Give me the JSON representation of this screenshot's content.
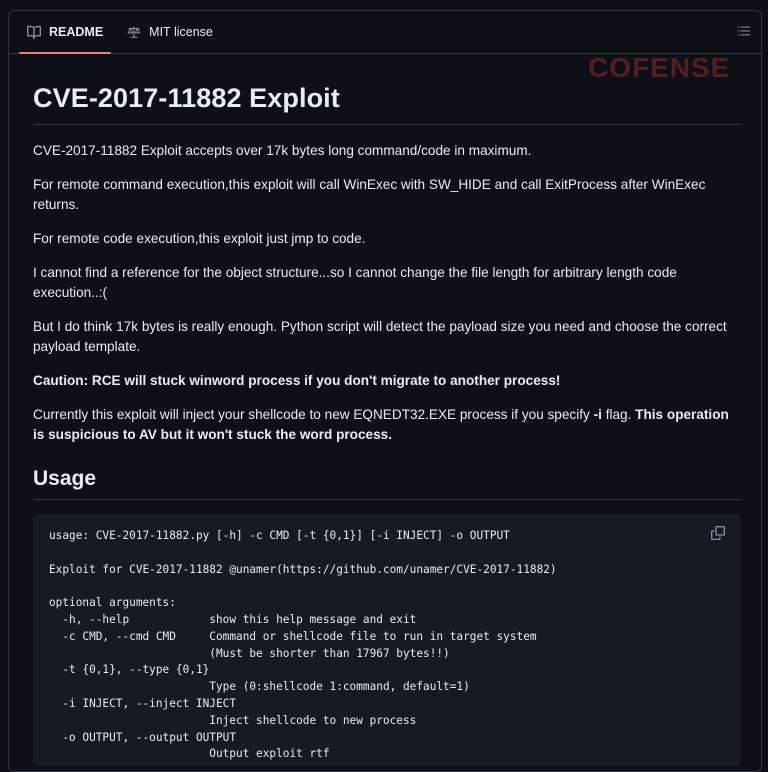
{
  "tabs": [
    {
      "label": "README",
      "icon": "book-icon",
      "active": true
    },
    {
      "label": "MIT license",
      "icon": "scale-icon",
      "active": false
    }
  ],
  "watermark": {
    "text": "COFENSE"
  },
  "title": "CVE-2017-11882 Exploit",
  "paragraphs": [
    "CVE-2017-11882 Exploit accepts over 17k bytes long command/code in maximum.",
    "For remote command execution,this exploit will call WinExec with SW_HIDE and call ExitProcess after WinExec returns.",
    "For remote code execution,this exploit just jmp to code.",
    "I cannot find a reference for the object structure...so I cannot change the file length for arbitrary length code execution..:(",
    "But I do think 17k bytes is really enough. Python script will detect the payload size you need and choose the correct payload template."
  ],
  "caution": "Caution: RCE will stuck winword process if you don't migrate to another process!",
  "currently": {
    "pre": "Currently this exploit will inject your shellcode to new EQNEDT32.EXE process if you specify ",
    "flag": "-i",
    "mid": " flag. ",
    "bold": "This operation is suspicious to AV but it won't stuck the word process."
  },
  "usage_heading": "Usage",
  "code": "usage: CVE-2017-11882.py [-h] -c CMD [-t {0,1}] [-i INJECT] -o OUTPUT\n\nExploit for CVE-2017-11882 @unamer(https://github.com/unamer/CVE-2017-11882)\n\noptional arguments:\n  -h, --help            show this help message and exit\n  -c CMD, --cmd CMD     Command or shellcode file to run in target system\n                        (Must be shorter than 17967 bytes!!)\n  -t {0,1}, --type {0,1}\n                        Type (0:shellcode 1:command, default=1)\n  -i INJECT, --inject INJECT\n                        Inject shellcode to new process\n  -o OUTPUT, --output OUTPUT\n                        Output exploit rtf",
  "colors": {
    "bg": "#0d1117",
    "border": "#30363d",
    "code_bg": "#161b22",
    "accent": "#f78166",
    "muted": "#8b949e"
  }
}
